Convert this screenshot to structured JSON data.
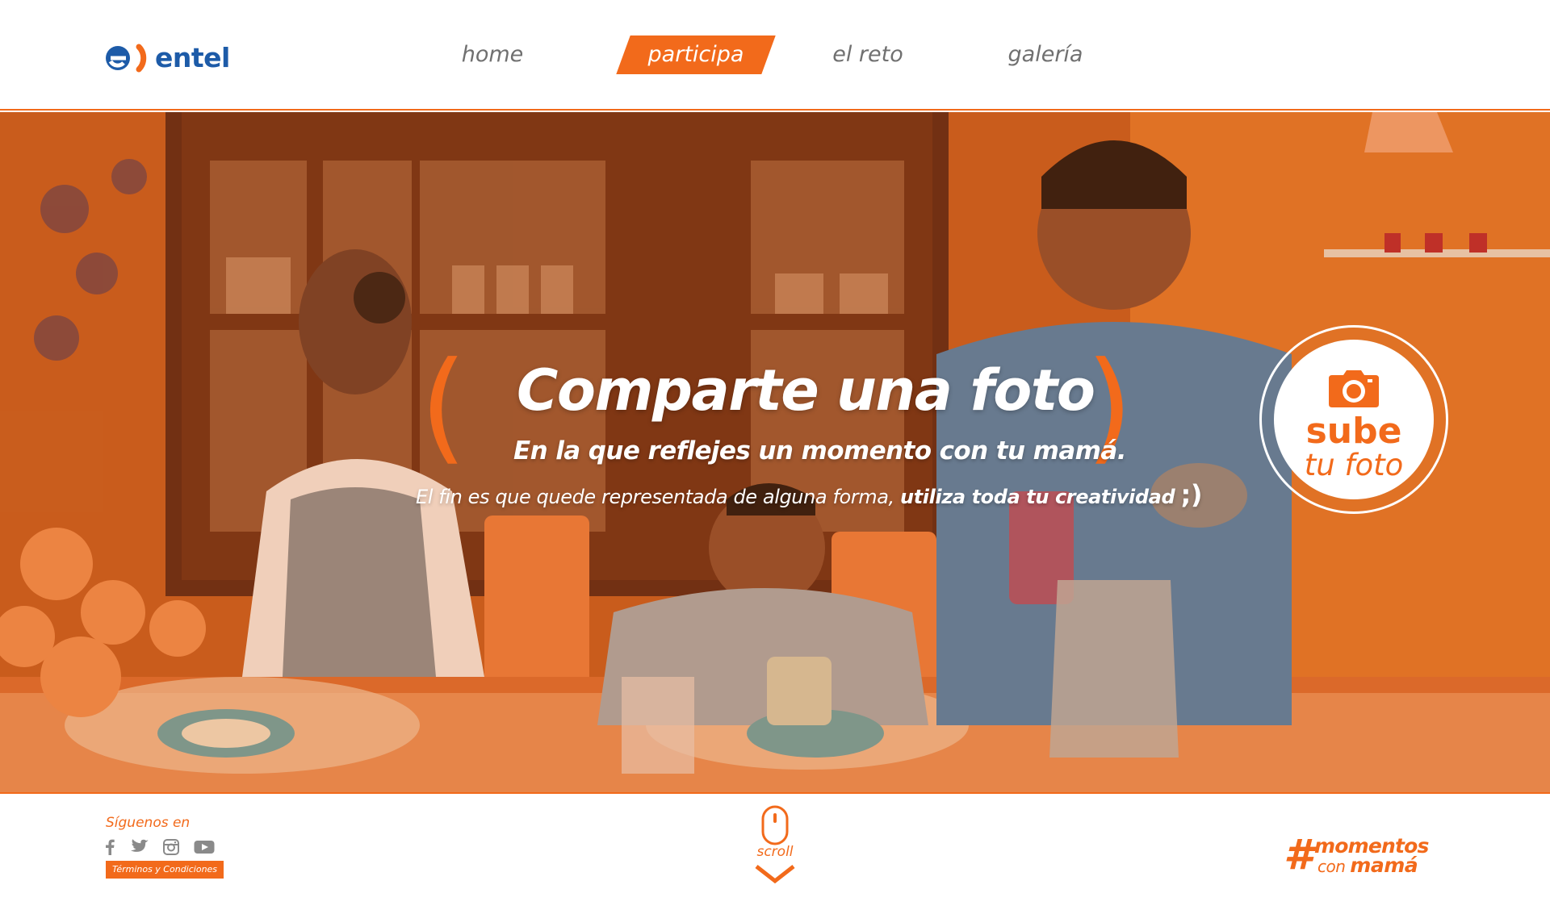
{
  "brand": {
    "name": "entel",
    "color_blue": "#1d5ba8",
    "color_orange": "#f26a1b"
  },
  "nav": {
    "items": [
      {
        "label": "home",
        "active": false
      },
      {
        "label": "participa",
        "active": true
      },
      {
        "label": "el reto",
        "active": false
      },
      {
        "label": "galería",
        "active": false
      }
    ]
  },
  "hero": {
    "background": "family-breakfast-photo",
    "headline": "Comparte una foto",
    "subheadline": "En la que reflejes un momento con tu mamá.",
    "tagline_regular": "El fin es que quede representada de alguna forma,",
    "tagline_bold": "utiliza toda tu creatividad",
    "tagline_wink": ";)",
    "upload": {
      "line1": "sube",
      "line2": "tu foto",
      "icon": "camera-icon"
    }
  },
  "footer": {
    "follow_label": "Síguenos en",
    "social": [
      "facebook-icon",
      "twitter-icon",
      "instagram-icon",
      "youtube-icon"
    ],
    "terms_label": "Términos y Condiciones",
    "scroll_label": "scroll",
    "hashtag": {
      "symbol": "#",
      "line1": "momentos",
      "line2_prefix": "con",
      "line2_bold": "mamá"
    }
  }
}
